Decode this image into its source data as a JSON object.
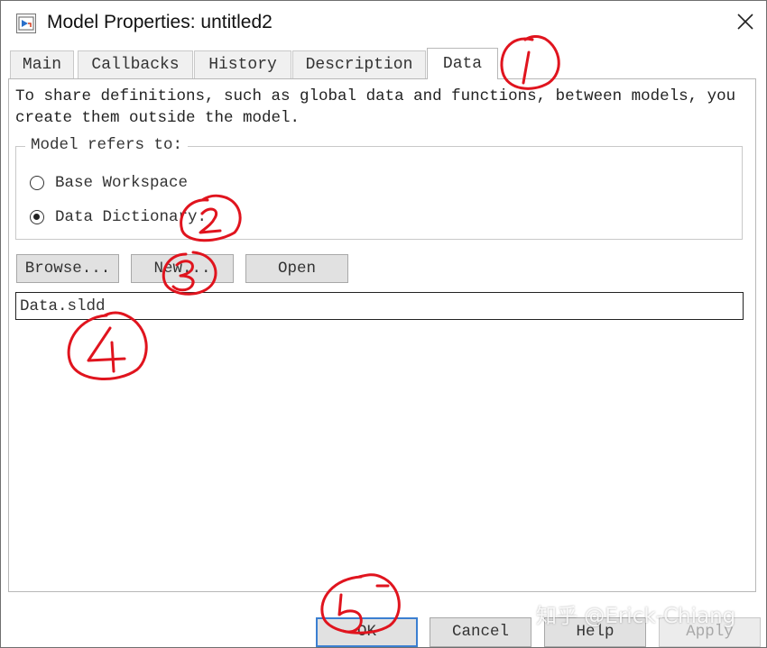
{
  "window": {
    "title": "Model Properties: untitled2"
  },
  "icons": {
    "app": "simulink-model-icon",
    "close": "close-icon"
  },
  "tabs": [
    {
      "label": "Main",
      "active": false
    },
    {
      "label": "Callbacks",
      "active": false
    },
    {
      "label": "History",
      "active": false
    },
    {
      "label": "Description",
      "active": false
    },
    {
      "label": "Data",
      "active": true
    }
  ],
  "data_tab": {
    "info_line1": "To share definitions, such as global data and functions, between models, you",
    "info_line2": "create them outside the model.",
    "group_label": "Model refers to:",
    "options": [
      {
        "label": "Base Workspace",
        "selected": false
      },
      {
        "label": "Data Dictionary:",
        "selected": true
      }
    ],
    "buttons": {
      "browse": "Browse...",
      "new": "New...",
      "open": "Open"
    },
    "dictionary_file": "Data.sldd"
  },
  "footer": {
    "ok": "OK",
    "cancel": "Cancel",
    "help": "Help",
    "apply": "Apply",
    "apply_enabled": false
  },
  "annotations": {
    "color": "#e0141e",
    "numbers": [
      "1",
      "2",
      "3",
      "4",
      "5"
    ]
  },
  "watermark": "知乎 @Erick-Chiang",
  "colors": {
    "button_face": "#e1e1e1",
    "default_button_border": "#3b7fd1",
    "annotation_red": "#e0141e"
  }
}
